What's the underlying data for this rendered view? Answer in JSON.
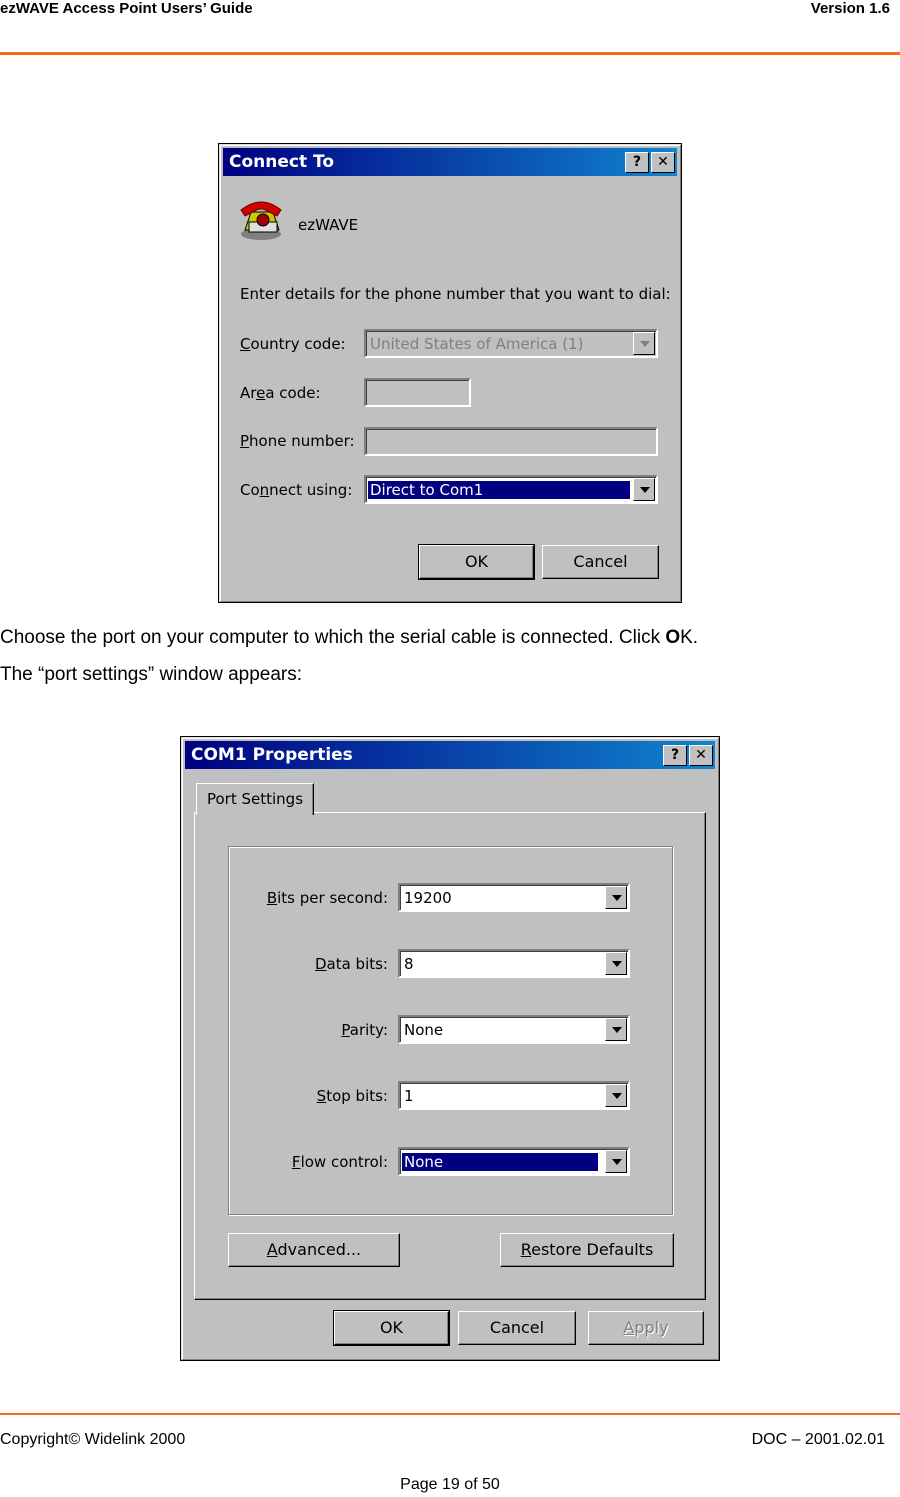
{
  "header": {
    "left": "ezWAVE Access Point Users’ Guide",
    "right": "Version 1.6"
  },
  "connect_dialog": {
    "title": "Connect To",
    "help_button": "?",
    "close_button": "✕",
    "connection_name": "ezWAVE",
    "instruction": "Enter details for the phone number that you want to dial:",
    "country_label": {
      "pre": "",
      "key": "C",
      "post": "ountry code:"
    },
    "country_value": "United States of America (1)",
    "area_label": {
      "pre": "Ar",
      "key": "e",
      "post": "a code:"
    },
    "area_value": "",
    "phone_label": {
      "pre": "",
      "key": "P",
      "post": "hone number:"
    },
    "phone_value": "",
    "connect_label": {
      "pre": "Co",
      "key": "n",
      "post": "nect using:"
    },
    "connect_value": "Direct to Com1",
    "ok": "OK",
    "cancel": "Cancel"
  },
  "paragraph1": {
    "pre": "Choose the port on your computer to which the serial cable is connected. Click ",
    "bold": "O",
    "post": "K."
  },
  "paragraph2": "The “port settings” window appears:",
  "com_dialog": {
    "title": "COM1 Properties",
    "help_button": "?",
    "close_button": "✕",
    "tab": "Port Settings",
    "bits_label": {
      "pre": "",
      "key": "B",
      "post": "its per second:"
    },
    "bits_value": "19200",
    "data_label": {
      "pre": "",
      "key": "D",
      "post": "ata bits:"
    },
    "data_value": "8",
    "parity_label": {
      "pre": "",
      "key": "P",
      "post": "arity:"
    },
    "parity_value": "None",
    "stop_label": {
      "pre": "",
      "key": "S",
      "post": "top bits:"
    },
    "stop_value": "1",
    "flow_label": {
      "pre": "",
      "key": "F",
      "post": "low control:"
    },
    "flow_value": "None",
    "advanced": {
      "pre": "",
      "key": "A",
      "post": "dvanced..."
    },
    "restore": {
      "pre": "",
      "key": "R",
      "post": "estore Defaults"
    },
    "ok": "OK",
    "cancel": "Cancel",
    "apply": {
      "pre": "",
      "key": "A",
      "post": "pply"
    }
  },
  "footer": {
    "left": "Copyright© Widelink 2000",
    "right": "DOC – 2001.02.01",
    "page": "Page 19 of 50"
  }
}
